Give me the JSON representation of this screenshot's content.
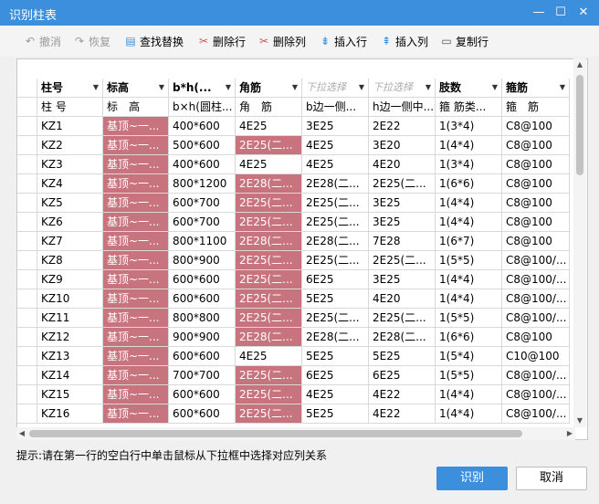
{
  "window": {
    "title": "识别柱表",
    "minimize": "—",
    "maximize": "☐",
    "close": "✕"
  },
  "toolbar": {
    "undo": "撤消",
    "redo": "恢复",
    "find_replace": "查找替换",
    "delete_row": "删除行",
    "delete_col": "删除列",
    "insert_row": "插入行",
    "insert_col": "插入列",
    "copy_row": "复制行"
  },
  "columns": [
    {
      "header": "柱号",
      "hint": false,
      "sub": "柱 号"
    },
    {
      "header": "标高",
      "hint": false,
      "sub": "标　高"
    },
    {
      "header": "b*h(...",
      "hint": false,
      "sub": "b×h(圆柱..."
    },
    {
      "header": "角筋",
      "hint": false,
      "sub": "角　筋"
    },
    {
      "header": "下拉选择",
      "hint": true,
      "sub": "b边一侧..."
    },
    {
      "header": "下拉选择",
      "hint": true,
      "sub": "h边一侧中..."
    },
    {
      "header": "肢数",
      "hint": false,
      "sub": "箍 筋类..."
    },
    {
      "header": "箍筋",
      "hint": false,
      "sub": "箍　筋"
    }
  ],
  "rows": [
    [
      "KZ1",
      "基顶~一...",
      "400*600",
      "4E25",
      "3E25",
      "2E22",
      "1(3*4)",
      "C8@100"
    ],
    [
      "KZ2",
      "基顶~一...",
      "500*600",
      "2E25(二...",
      "4E25",
      "3E20",
      "1(4*4)",
      "C8@100"
    ],
    [
      "KZ3",
      "基顶~一...",
      "400*600",
      "4E25",
      "4E25",
      "4E20",
      "1(3*4)",
      "C8@100"
    ],
    [
      "KZ4",
      "基顶~一...",
      "800*1200",
      "2E28(二...",
      "2E28(二...",
      "2E25(二...",
      "1(6*6)",
      "C8@100"
    ],
    [
      "KZ5",
      "基顶~一...",
      "600*700",
      "2E25(二...",
      "2E25(二...",
      "3E25",
      "1(4*4)",
      "C8@100"
    ],
    [
      "KZ6",
      "基顶~一...",
      "600*700",
      "2E25(二...",
      "2E25(二...",
      "3E25",
      "1(4*4)",
      "C8@100"
    ],
    [
      "KZ7",
      "基顶~一...",
      "800*1100",
      "2E28(二...",
      "2E28(二...",
      "7E28",
      "1(6*7)",
      "C8@100"
    ],
    [
      "KZ8",
      "基顶~一...",
      "800*900",
      "2E25(二...",
      "2E25(二...",
      "2E25(二...",
      "1(5*5)",
      "C8@100/..."
    ],
    [
      "KZ9",
      "基顶~一...",
      "600*600",
      "2E25(二...",
      "6E25",
      "3E25",
      "1(4*4)",
      "C8@100/..."
    ],
    [
      "KZ10",
      "基顶~一...",
      "600*600",
      "2E25(二...",
      "5E25",
      "4E20",
      "1(4*4)",
      "C8@100/..."
    ],
    [
      "KZ11",
      "基顶~一...",
      "800*800",
      "2E25(二...",
      "2E25(二...",
      "2E25(二...",
      "1(5*5)",
      "C8@100/..."
    ],
    [
      "KZ12",
      "基顶~一...",
      "900*900",
      "2E28(二...",
      "2E28(二...",
      "2E28(二...",
      "1(6*6)",
      "C8@100"
    ],
    [
      "KZ13",
      "基顶~一...",
      "600*600",
      "4E25",
      "5E25",
      "5E25",
      "1(5*4)",
      "C10@100"
    ],
    [
      "KZ14",
      "基顶~一...",
      "700*700",
      "2E25(二...",
      "6E25",
      "6E25",
      "1(5*5)",
      "C8@100/..."
    ],
    [
      "KZ15",
      "基顶~一...",
      "600*600",
      "2E25(二...",
      "4E25",
      "4E22",
      "1(4*4)",
      "C8@100/..."
    ],
    [
      "KZ16",
      "基顶~一...",
      "600*600",
      "2E25(二...",
      "5E25",
      "4E22",
      "1(4*4)",
      "C8@100/..."
    ]
  ],
  "pink_cells": {
    "col1": [
      0,
      1,
      2,
      3,
      4,
      5,
      6,
      7,
      8,
      9,
      10,
      11,
      12,
      13,
      14,
      15
    ],
    "col3": [
      1,
      3,
      4,
      5,
      6,
      7,
      8,
      9,
      10,
      11,
      13,
      14,
      15
    ]
  },
  "colors": {
    "accent": "#3c8fdc",
    "highlight": "#c8747e"
  },
  "hint": "提示:请在第一行的空白行中单击鼠标从下拉框中选择对应列关系",
  "buttons": {
    "ok": "识别",
    "cancel": "取消"
  }
}
